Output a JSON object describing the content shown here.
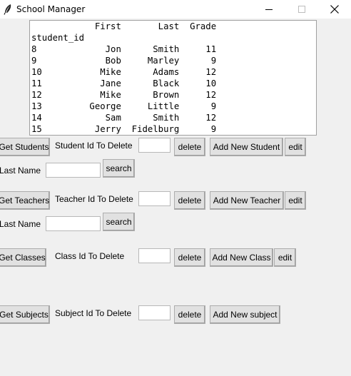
{
  "window": {
    "title": "School Manager"
  },
  "table_text": "            First       Last  Grade\nstudent_id                          \n8             Jon      Smith     11\n9             Bob     Marley      9\n10           Mike      Adams     12\n11           Jane      Black     10\n12           Mike      Brown     12\n13         George     Little      9\n14            Sam      Smith     12\n15          Jerry  Fidelburg      9",
  "students": {
    "get_label": "Get Students",
    "delete_id_label": "Student Id To Delete",
    "delete_id_value": "",
    "delete_label": "delete",
    "add_label": "Add New Student",
    "edit_label": "edit",
    "last_name_label": "Last Name",
    "last_name_value": "",
    "search_label": "search"
  },
  "teachers": {
    "get_label": "Get Teachers",
    "delete_id_label": "Teacher Id To Delete",
    "delete_id_value": "",
    "delete_label": "delete",
    "add_label": "Add New Teacher",
    "edit_label": "edit",
    "last_name_label": "Last Name",
    "last_name_value": "",
    "search_label": "search"
  },
  "classes": {
    "get_label": "Get Classes",
    "delete_id_label": "Class Id To Delete",
    "delete_id_value": "",
    "delete_label": "delete",
    "add_label": "Add New Class",
    "edit_label": "edit"
  },
  "subjects": {
    "get_label": "Get Subjects",
    "delete_id_label": "Subject Id To Delete",
    "delete_id_value": "",
    "delete_label": "delete",
    "add_label": "Add New subject"
  },
  "icons": {
    "app": "feather-icon",
    "minimize": "minimize-icon",
    "maximize": "maximize-icon",
    "close": "close-icon"
  }
}
